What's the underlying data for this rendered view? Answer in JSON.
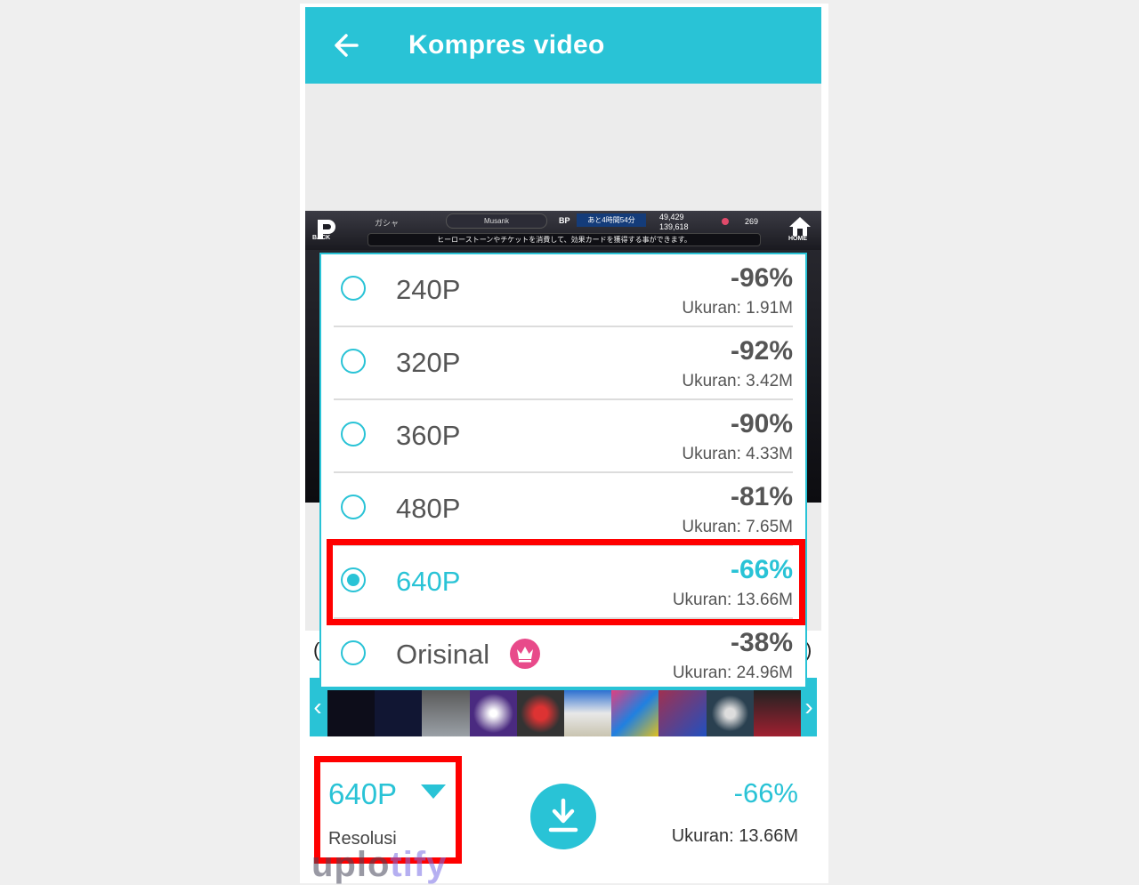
{
  "app_bar": {
    "title": "Kompres video",
    "back_icon": "arrow-left-icon",
    "color": "#29c3d6"
  },
  "video_preview": {
    "game_ui": {
      "back_label": "BACK",
      "tab_label": "ガシャ",
      "player_name": "Musank",
      "bp_label": "BP",
      "timer": "あと4時間54分",
      "currency_1": "49,429",
      "currency_2": "139,618",
      "gem_count": "269",
      "info_text": "ヒーローストーンやチケットを消費して、効果カードを獲得する事ができます。",
      "home_label": "HOME"
    }
  },
  "resolution_options": [
    {
      "label": "240P",
      "percent": "-96%",
      "size": "Ukuran: 1.91M",
      "selected": false,
      "premium": false
    },
    {
      "label": "320P",
      "percent": "-92%",
      "size": "Ukuran: 3.42M",
      "selected": false,
      "premium": false
    },
    {
      "label": "360P",
      "percent": "-90%",
      "size": "Ukuran: 4.33M",
      "selected": false,
      "premium": false
    },
    {
      "label": "480P",
      "percent": "-81%",
      "size": "Ukuran: 7.65M",
      "selected": false,
      "premium": false
    },
    {
      "label": "640P",
      "percent": "-66%",
      "size": "Ukuran: 13.66M",
      "selected": true,
      "premium": false
    },
    {
      "label": "Orisinal",
      "percent": "-38%",
      "size": "Ukuran: 24.96M",
      "selected": false,
      "premium": true,
      "premium_icon": "crown-icon"
    }
  ],
  "filmstrip": {
    "left_arrow": "‹",
    "right_arrow": "›",
    "thumbnail_count": 10
  },
  "bottom_bar": {
    "resolution": "640P",
    "resolution_caption": "Resolusi",
    "dropdown_icon": "caret-down-icon",
    "download_icon": "download-icon",
    "percent": "-66%",
    "size": "Ukuran: 13.66M"
  },
  "watermark": {
    "text_main": "uplo",
    "text_tail": "tify"
  },
  "colors": {
    "accent": "#29c3d6",
    "highlight": "#ff0000",
    "premium": "#e84a8a"
  }
}
